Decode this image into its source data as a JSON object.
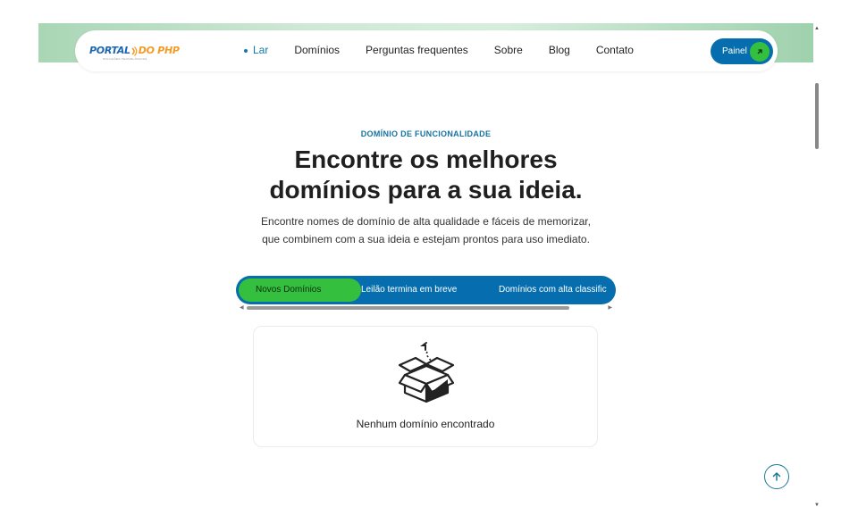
{
  "header": {
    "logo": {
      "part1": "PORTAL",
      "part2": "DO PHP",
      "tagline": "SOLUÇÕES TECNOLÓGICAS"
    },
    "nav": [
      {
        "label": "Lar",
        "active": true
      },
      {
        "label": "Domínios",
        "active": false
      },
      {
        "label": "Perguntas frequentes",
        "active": false
      },
      {
        "label": "Sobre",
        "active": false
      },
      {
        "label": "Blog",
        "active": false
      },
      {
        "label": "Contato",
        "active": false
      }
    ],
    "panel_button": {
      "label": "Painel",
      "icon": "arrow-up-right-icon"
    }
  },
  "hero": {
    "eyebrow": "DOMÍNIO DE FUNCIONALIDADE",
    "title_line1": "Encontre os melhores",
    "title_line2": "domínios para a sua ideia.",
    "description_line1": "Encontre nomes de domínio de alta qualidade e fáceis de memorizar,",
    "description_line2": "que combinem com a sua ideia e estejam prontos para uso imediato."
  },
  "tabs": [
    {
      "label": "Novos Domínios",
      "active": true
    },
    {
      "label": "Leilão termina em breve",
      "active": false
    },
    {
      "label": "Domínios com alta classific",
      "active": false
    }
  ],
  "empty_state": {
    "icon": "open-box-icon",
    "message": "Nenhum domínio encontrado"
  },
  "scroll_to_top": {
    "icon": "arrow-up-icon"
  },
  "colors": {
    "primary_blue": "#066eae",
    "accent_green": "#34c03e",
    "link_blue": "#1278a8",
    "logo_orange": "#f39b25"
  }
}
